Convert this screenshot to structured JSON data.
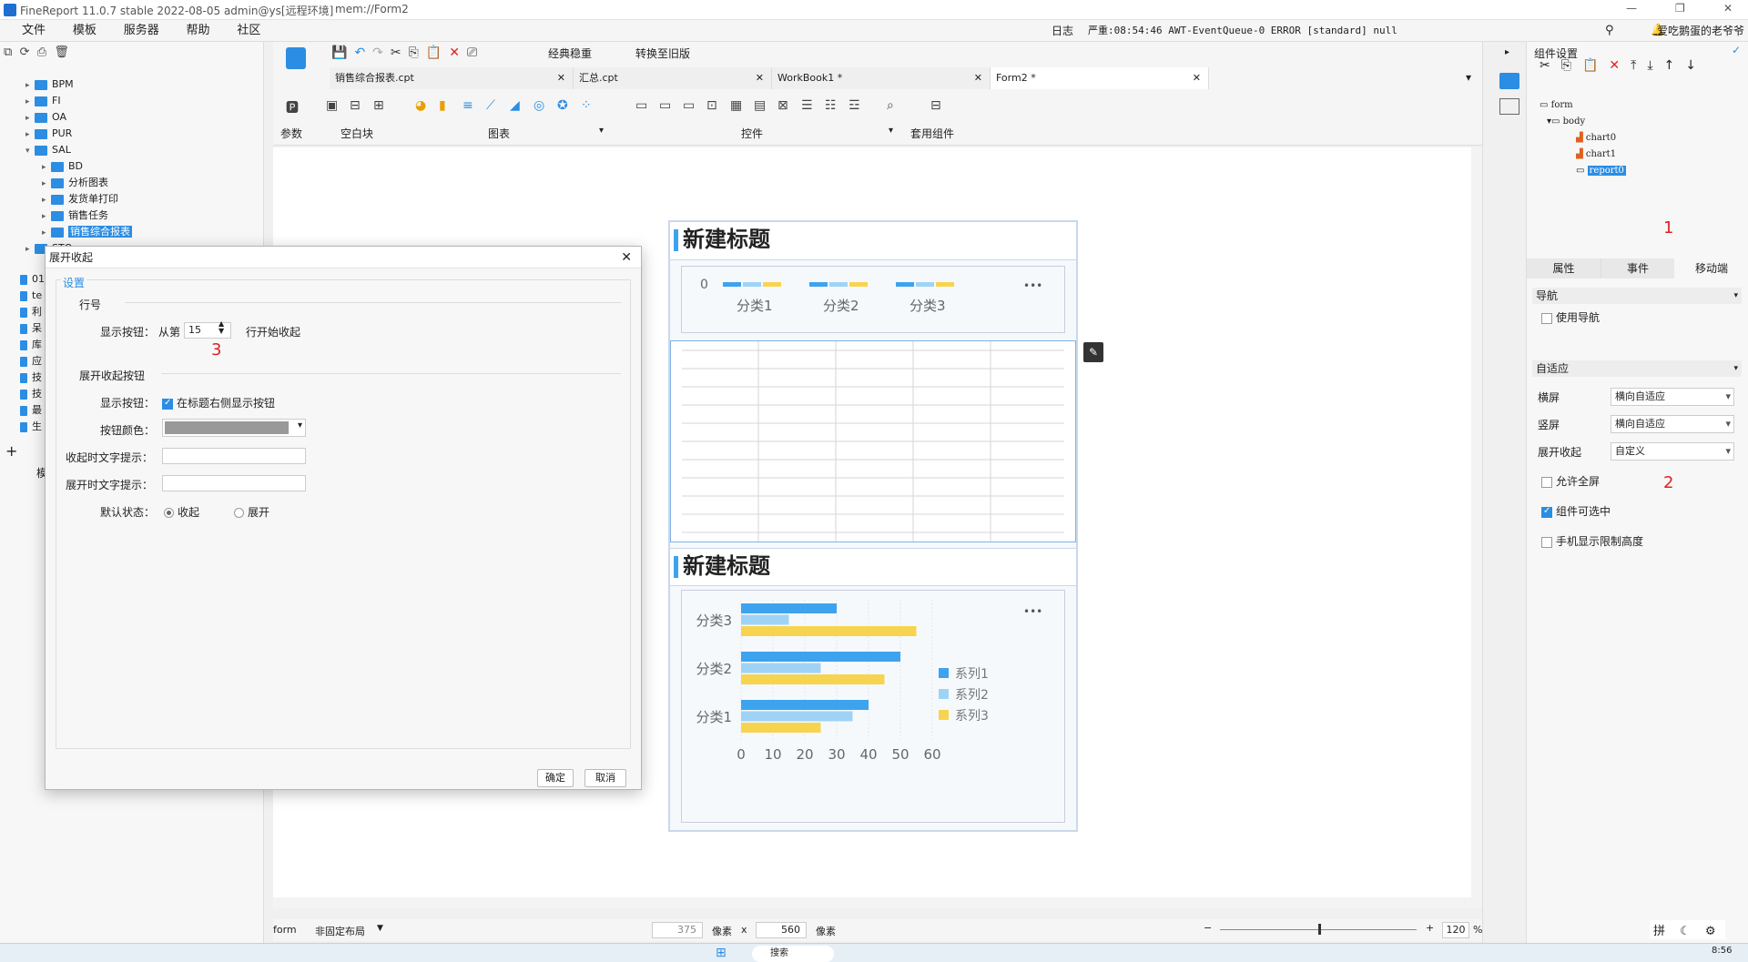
{
  "app": {
    "title": "FineReport 11.0.7 stable 2022-08-05 admin@ys[远程环境]",
    "file": "mem://Form2"
  },
  "window": {
    "log_label": "日志",
    "log_text": "严重:08:54:46 AWT-EventQueue-0 ERROR [standard] null",
    "user": "爱吃鹅蛋的老爷爷"
  },
  "menu": [
    "文件",
    "模板",
    "服务器",
    "帮助",
    "社区"
  ],
  "tree": {
    "items": [
      {
        "label": "BPM"
      },
      {
        "label": "FI"
      },
      {
        "label": "OA"
      },
      {
        "label": "PUR"
      },
      {
        "label": "SAL"
      },
      {
        "label": "BD"
      },
      {
        "label": "分析图表"
      },
      {
        "label": "发货单打印"
      },
      {
        "label": "销售任务"
      },
      {
        "label": "销售综合报表"
      },
      {
        "label": "STO"
      },
      {
        "label": "01"
      },
      {
        "label": "te"
      },
      {
        "label": "利"
      },
      {
        "label": "呆"
      },
      {
        "label": "库"
      },
      {
        "label": "应"
      },
      {
        "label": "技"
      },
      {
        "label": "技"
      },
      {
        "label": "最"
      },
      {
        "label": "生"
      }
    ],
    "bottom_label": "模"
  },
  "toolbar": {
    "classic": "经典稳重",
    "convert": "转换至旧版",
    "tabs": [
      "销售综合报表.cpt",
      "汇总.cpt",
      "WorkBook1 *",
      "Form2 *"
    ],
    "groups": [
      "参数",
      "空白块",
      "图表",
      "控件",
      "套用组件"
    ]
  },
  "canvas": {
    "title1": "新建标题",
    "title2": "新建标题",
    "chart1": {
      "zero": "0",
      "cats": [
        "分类1",
        "分类2",
        "分类3"
      ],
      "more": "•••"
    },
    "chart2": {
      "more": "•••"
    }
  },
  "chart_data": {
    "type": "bar",
    "orientation": "horizontal",
    "categories": [
      "分类3",
      "分类2",
      "分类1"
    ],
    "series": [
      {
        "name": "系列1",
        "color": "#3da3ee",
        "values": [
          30,
          50,
          40
        ]
      },
      {
        "name": "系列2",
        "color": "#9fd3f5",
        "values": [
          15,
          25,
          35
        ]
      },
      {
        "name": "系列3",
        "color": "#f7d450",
        "values": [
          55,
          45,
          25
        ]
      }
    ],
    "xticks": [
      "0",
      "10",
      "20",
      "30",
      "40",
      "50",
      "60"
    ],
    "xlim": [
      0,
      60
    ],
    "legend": "right"
  },
  "status": {
    "layout": "form",
    "mode": "非固定布局",
    "width": "375",
    "unit1": "像素",
    "x": "x",
    "height": "560",
    "unit2": "像素",
    "zoom": "120",
    "pct": "%"
  },
  "right": {
    "header": "组件设置",
    "tree": [
      "form",
      "body",
      "chart0",
      "chart1",
      "report0"
    ],
    "marker1": "1",
    "marker2": "2",
    "marker3": "3",
    "tabs": [
      "属性",
      "事件",
      "移动端"
    ],
    "nav_section": "导航",
    "use_nav": "使用导航",
    "adapt_section": "自适应",
    "landscape": "横屏",
    "landscape_val": "横向自适应",
    "portrait": "竖屏",
    "portrait_val": "横向自适应",
    "collapse": "展开收起",
    "collapse_val": "自定义",
    "fullscreen": "允许全屏",
    "selectable": "组件可选中",
    "limit_height": "手机显示限制高度"
  },
  "dialog": {
    "title": "展开收起",
    "settings": "设置",
    "row_section": "行号",
    "show_btn": "显示按钮：",
    "from": "从第",
    "row_value": "15",
    "start": "行开始收起",
    "btn_section": "展开收起按钮",
    "show_btn2": "显示按钮：",
    "show_right": "在标题右侧显示按钮",
    "btn_color": "按钮颜色：",
    "collapse_tip": "收起时文字提示：",
    "expand_tip": "展开时文字提示：",
    "default_state": "默认状态：",
    "collapsed": "收起",
    "expanded": "展开",
    "ok": "确定",
    "cancel": "取消"
  },
  "taskbar": {
    "time": "8:56",
    "search": "搜索"
  }
}
